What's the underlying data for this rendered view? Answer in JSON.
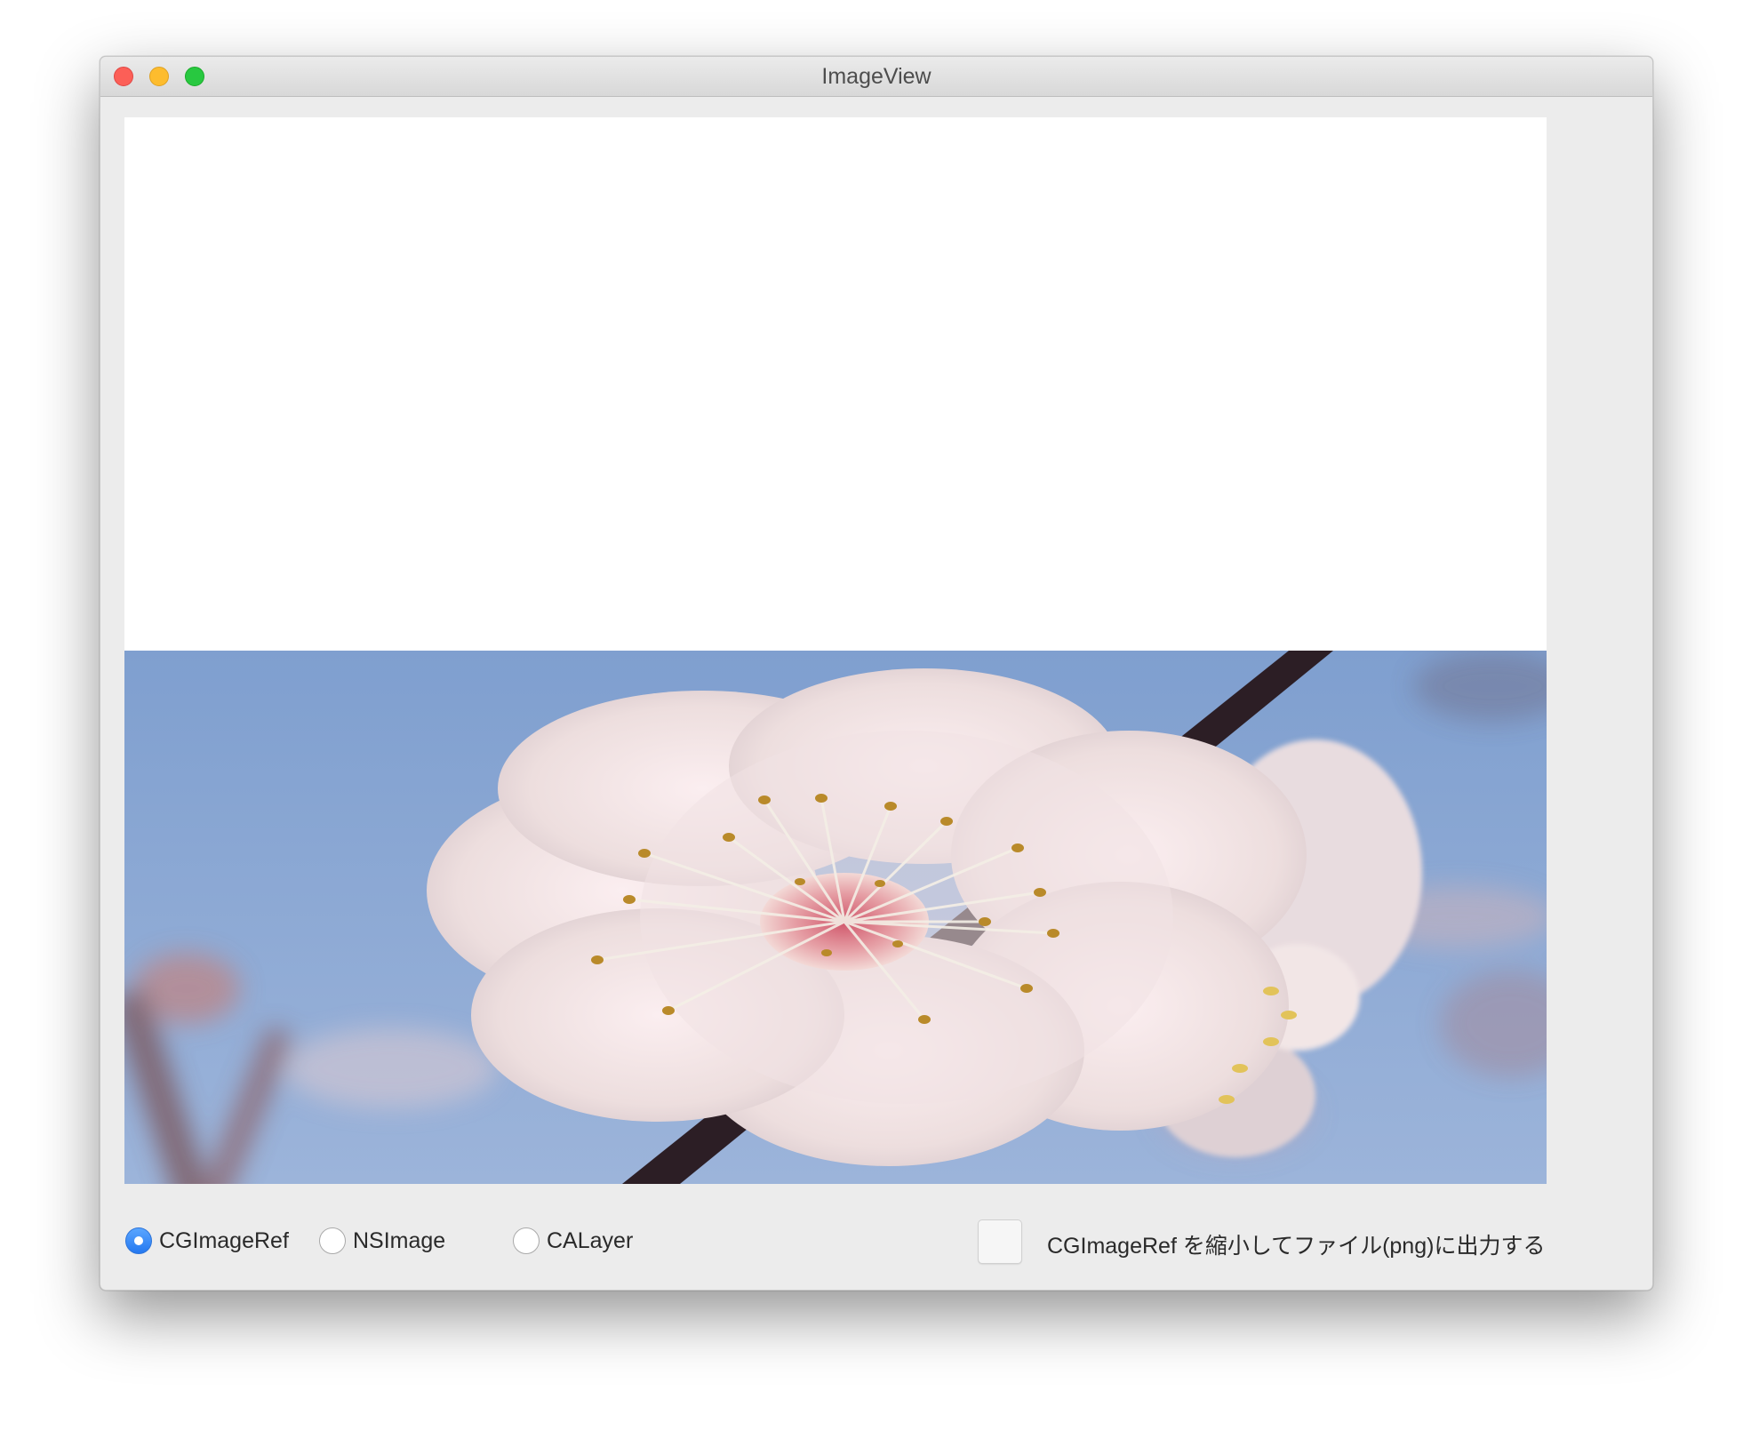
{
  "window": {
    "title": "ImageView"
  },
  "image_view": {
    "image_description": "white plum blossom against blue sky with dark branch"
  },
  "render_options": {
    "radios": [
      {
        "label": "CGImageRef",
        "selected": true
      },
      {
        "label": "NSImage",
        "selected": false
      },
      {
        "label": "CALayer",
        "selected": false
      }
    ],
    "checkbox": {
      "label": "CGImageRef を縮小してファイル(png)に出力する",
      "checked": false
    }
  },
  "colors": {
    "accent": "#2478f0",
    "close": "#fc5f57",
    "minimize": "#fdbc2e",
    "maximize": "#28c840",
    "sky": "#8eaad4"
  }
}
